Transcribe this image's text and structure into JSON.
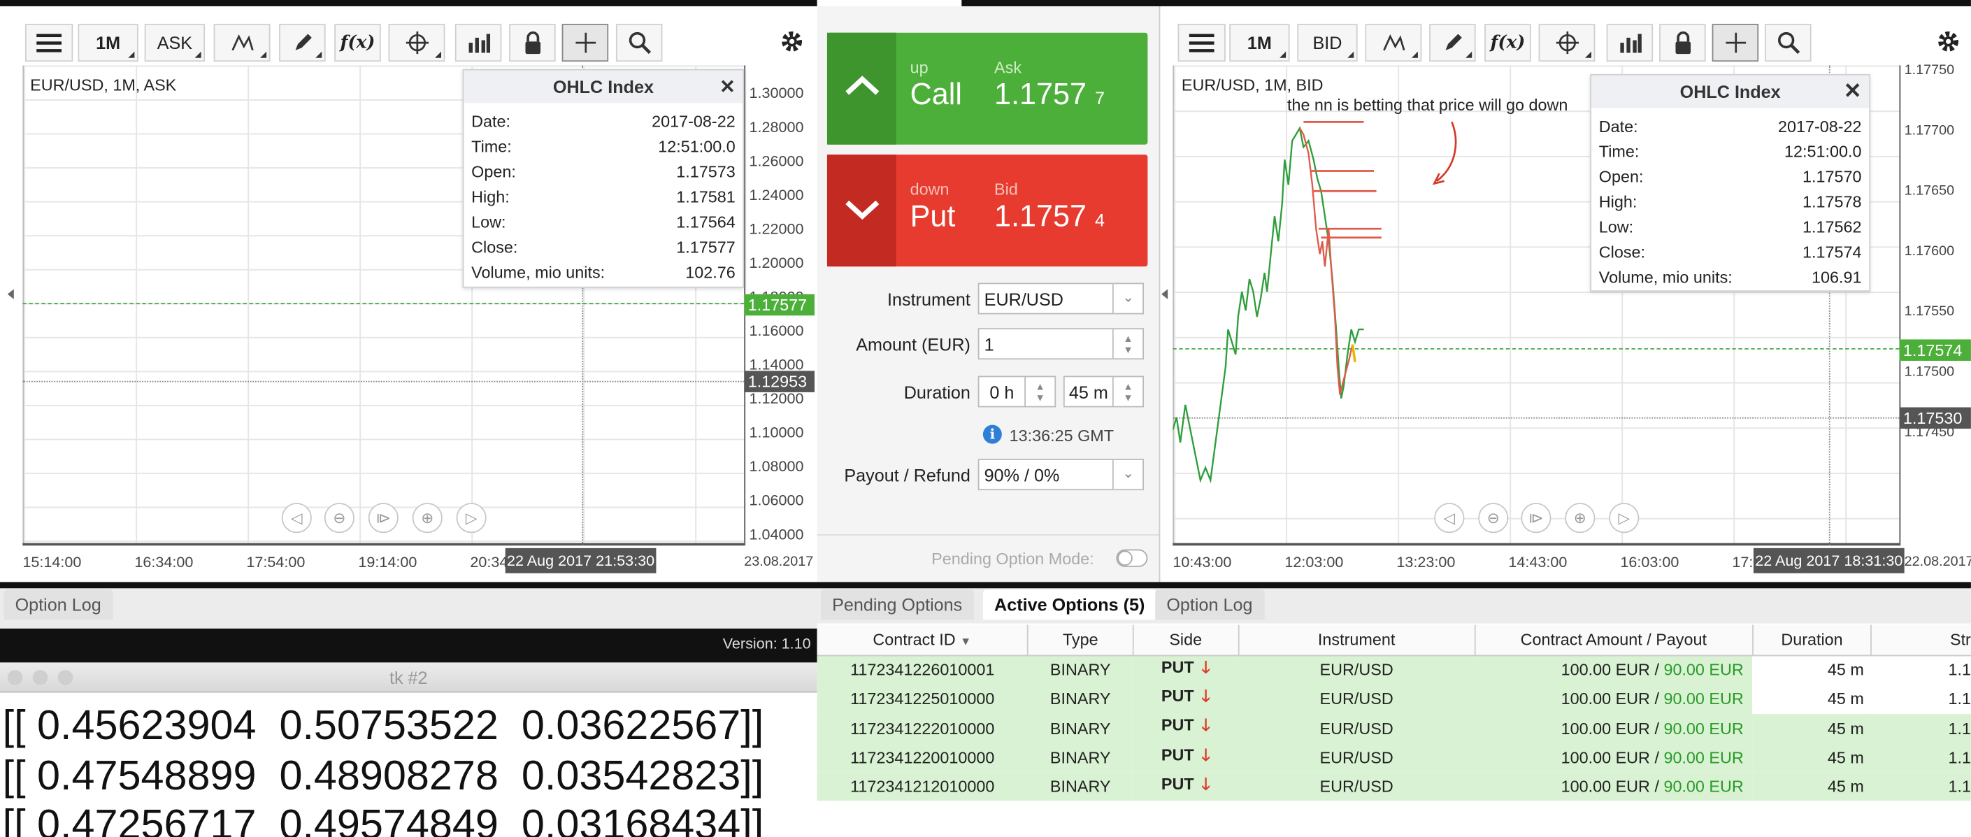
{
  "left_chart": {
    "toolbar": {
      "period": "1M",
      "price_type": "ASK"
    },
    "title": "EUR/USD, 1M, ASK",
    "ohlc": {
      "title": "OHLC Index",
      "rows": [
        {
          "label": "Date:",
          "value": "2017-08-22"
        },
        {
          "label": "Time:",
          "value": "12:51:00.0"
        },
        {
          "label": "Open:",
          "value": "1.17573"
        },
        {
          "label": "High:",
          "value": "1.17581"
        },
        {
          "label": "Low:",
          "value": "1.17564"
        },
        {
          "label": "Close:",
          "value": "1.17577"
        },
        {
          "label": "Volume, mio units:",
          "value": "102.76"
        }
      ]
    },
    "y_ticks": [
      "1.30000",
      "1.28000",
      "1.26000",
      "1.24000",
      "1.22000",
      "1.20000",
      "1.18000",
      "1.16000",
      "1.14000",
      "1.12000",
      "1.10000",
      "1.08000",
      "1.06000",
      "1.04000"
    ],
    "price_tag": "1.17577",
    "cursor_tag": "1.12953",
    "x_ticks": [
      "15:14:00",
      "16:34:00",
      "17:54:00",
      "19:14:00",
      "20:34"
    ],
    "cursor_time": "22 Aug 2017 21:53:30",
    "date_label": "23.08.2017"
  },
  "trade_panel": {
    "call": {
      "direction": "up",
      "label": "Call",
      "price_label": "Ask",
      "price": "1.1757",
      "price_digit": "7"
    },
    "put": {
      "direction": "down",
      "label": "Put",
      "price_label": "Bid",
      "price": "1.1757",
      "price_digit": "4"
    },
    "instrument_label": "Instrument",
    "instrument": "EUR/USD",
    "amount_label": "Amount (EUR)",
    "amount": "1",
    "duration_label": "Duration",
    "duration_h": "0 h",
    "duration_m": "45 m",
    "time": "13:36:25 GMT",
    "payout_label": "Payout / Refund",
    "payout": "90% / 0%",
    "pending_mode": "Pending Option Mode:"
  },
  "right_chart": {
    "toolbar": {
      "period": "1M",
      "price_type": "BID"
    },
    "title": "EUR/USD, 1M, BID",
    "annotation": "the nn is betting that price will go down",
    "ohlc": {
      "title": "OHLC Index",
      "rows": [
        {
          "label": "Date:",
          "value": "2017-08-22"
        },
        {
          "label": "Time:",
          "value": "12:51:00.0"
        },
        {
          "label": "Open:",
          "value": "1.17570"
        },
        {
          "label": "High:",
          "value": "1.17578"
        },
        {
          "label": "Low:",
          "value": "1.17562"
        },
        {
          "label": "Close:",
          "value": "1.17574"
        },
        {
          "label": "Volume, mio units:",
          "value": "106.91"
        }
      ]
    },
    "y_ticks": [
      "1.17750",
      "1.17700",
      "1.17650",
      "1.17600",
      "1.17550",
      "1.17500",
      "1.17450"
    ],
    "price_tag": "1.17574",
    "cursor_tag": "1.17530",
    "x_ticks": [
      "10:43:00",
      "12:03:00",
      "13:23:00",
      "14:43:00",
      "16:03:00",
      "17:"
    ],
    "cursor_time": "22 Aug 2017 18:31:30",
    "date_label": "22.08.2017"
  },
  "bottom_left": {
    "tab": "Option Log",
    "version": "Version: 1.10",
    "window_title": "tk #2",
    "lines": [
      "[[ 0.45623904  0.50753522  0.03622567]]",
      "[[ 0.47548899  0.48908278  0.03542823]]",
      "[[ 0.47256717  0.49574849  0.03168434]]"
    ]
  },
  "options": {
    "tabs": [
      "Pending Options",
      "Active Options (5)",
      "Option Log"
    ],
    "columns": [
      "Contract ID",
      "Type",
      "Side",
      "Instrument",
      "Contract Amount / Payout",
      "Duration",
      "Str"
    ],
    "rows": [
      {
        "id": "1172341226010001",
        "type": "BINARY",
        "side": "PUT",
        "instrument": "EUR/USD",
        "amount": "100.00 EUR",
        "payout": "90.00 EUR",
        "duration": "45 m",
        "strike": "1.1"
      },
      {
        "id": "1172341225010000",
        "type": "BINARY",
        "side": "PUT",
        "instrument": "EUR/USD",
        "amount": "100.00 EUR",
        "payout": "90.00 EUR",
        "duration": "45 m",
        "strike": "1.1"
      },
      {
        "id": "1172341222010000",
        "type": "BINARY",
        "side": "PUT",
        "instrument": "EUR/USD",
        "amount": "100.00 EUR",
        "payout": "90.00 EUR",
        "duration": "45 m",
        "strike": "1.1"
      },
      {
        "id": "1172341220010000",
        "type": "BINARY",
        "side": "PUT",
        "instrument": "EUR/USD",
        "amount": "100.00 EUR",
        "payout": "90.00 EUR",
        "duration": "45 m",
        "strike": "1.1"
      },
      {
        "id": "1172341212010000",
        "type": "BINARY",
        "side": "PUT",
        "instrument": "EUR/USD",
        "amount": "100.00 EUR",
        "payout": "90.00 EUR",
        "duration": "45 m",
        "strike": "1.1"
      }
    ],
    "payout_color": "#2a9a2a"
  }
}
